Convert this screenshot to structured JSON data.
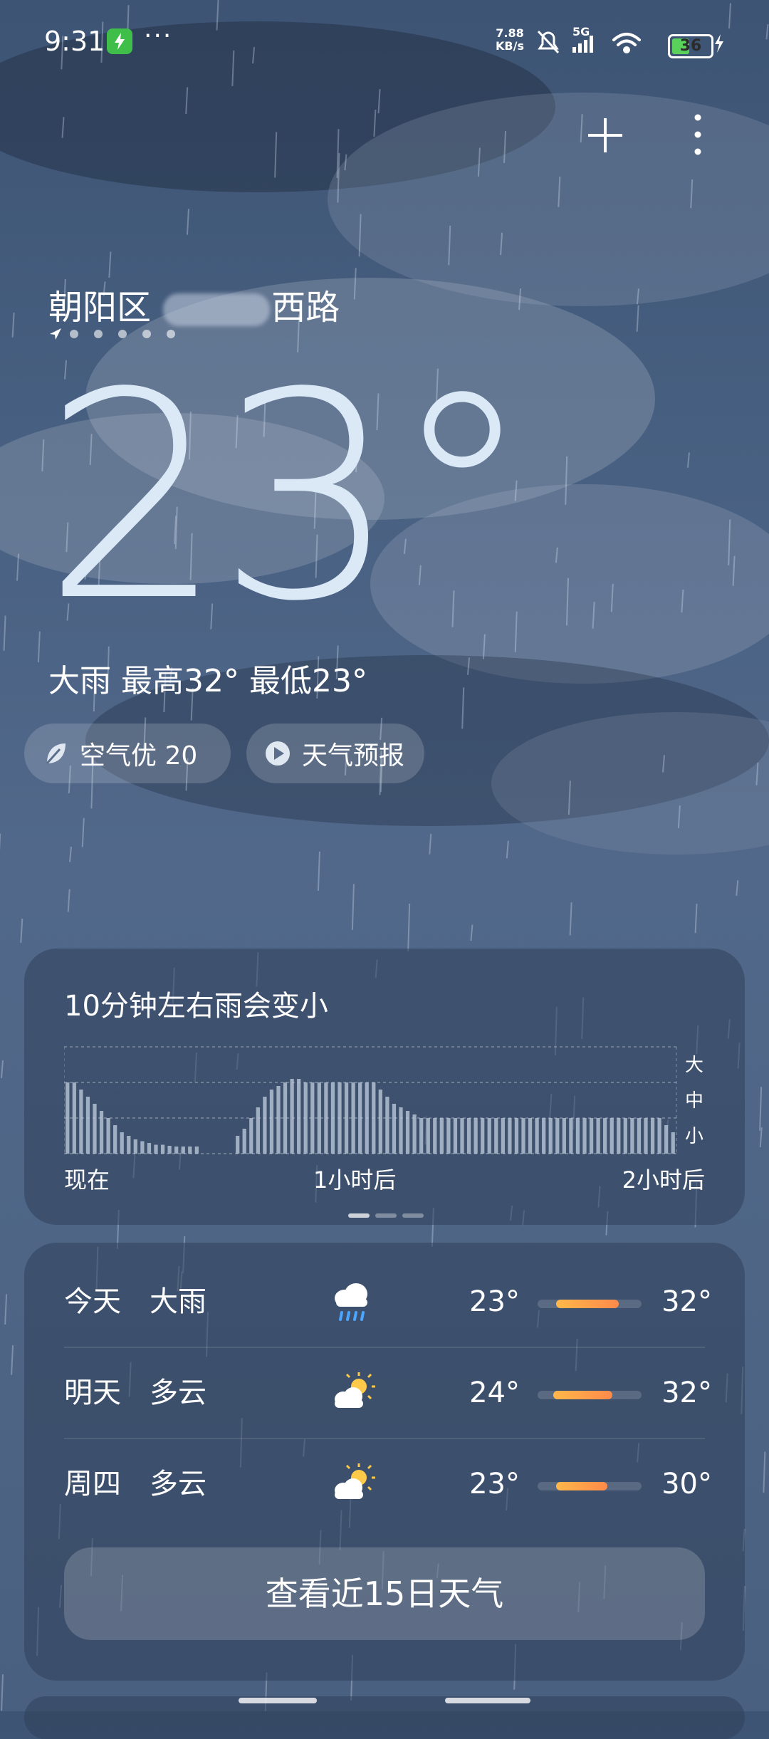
{
  "status_bar": {
    "time": "9:31",
    "more": "···",
    "net_speed_value": "7.88",
    "net_speed_unit": "KB/s",
    "network": "5G",
    "battery": "36"
  },
  "location": {
    "district": "朝阳区",
    "street_suffix": "西路",
    "pages": 6
  },
  "current": {
    "temperature": "23°",
    "summary": "大雨  最高32° 最低23°"
  },
  "chips": [
    {
      "label": "空气优 20",
      "icon": "leaf-icon"
    },
    {
      "label": "天气预报",
      "icon": "play-icon"
    }
  ],
  "nowcast": {
    "title": "10分钟左右雨会变小",
    "levels": [
      "大",
      "中",
      "小"
    ],
    "ticks": [
      "现在",
      "1小时后",
      "2小时后"
    ]
  },
  "chart_data": {
    "type": "bar",
    "title": "10分钟左右雨会变小",
    "xlabel": "",
    "ylabel": "",
    "x_ticks": [
      "现在",
      "1小时后",
      "2小时后"
    ],
    "y_levels": [
      "小",
      "中",
      "大"
    ],
    "ylim": [
      0,
      3
    ],
    "values": [
      2.0,
      2.0,
      1.8,
      1.6,
      1.4,
      1.2,
      1.0,
      0.8,
      0.6,
      0.5,
      0.4,
      0.35,
      0.3,
      0.25,
      0.25,
      0.22,
      0.2,
      0.2,
      0.2,
      0.2,
      0,
      0,
      0,
      0,
      0,
      0.5,
      0.7,
      1.0,
      1.3,
      1.6,
      1.8,
      1.9,
      2.0,
      2.1,
      2.1,
      2.0,
      2.0,
      2.0,
      2.0,
      2.0,
      2.0,
      2.0,
      2.0,
      2.0,
      2.0,
      2.0,
      1.8,
      1.6,
      1.4,
      1.3,
      1.2,
      1.1,
      1.0,
      1.0,
      1.0,
      1.0,
      1.0,
      1.0,
      1.0,
      1.0,
      1.0,
      1.0,
      1.0,
      1.0,
      1.0,
      1.0,
      1.0,
      1.0,
      1.0,
      1.0,
      1.0,
      1.0,
      1.0,
      1.0,
      1.0,
      1.0,
      1.0,
      1.0,
      1.0,
      1.0,
      1.0,
      1.0,
      1.0,
      1.0,
      1.0,
      1.0,
      1.0,
      1.0,
      0.8,
      0.6
    ]
  },
  "forecast": [
    {
      "day": "今天",
      "cond": "大雨",
      "icon": "heavy-rain-icon",
      "lo": "23°",
      "hi": "32°",
      "range": [
        0.18,
        0.78
      ]
    },
    {
      "day": "明天",
      "cond": "多云",
      "icon": "partly-cloudy-icon",
      "lo": "24°",
      "hi": "32°",
      "range": [
        0.15,
        0.72
      ]
    },
    {
      "day": "周四",
      "cond": "多云",
      "icon": "partly-cloudy-icon",
      "lo": "23°",
      "hi": "30°",
      "range": [
        0.18,
        0.67
      ]
    }
  ],
  "forecast_button": "查看近15日天气",
  "colors": {
    "bar_fill": "#b9c6d6",
    "range_fill": "#ffa24a",
    "temp_text": "#dbe9f7"
  }
}
